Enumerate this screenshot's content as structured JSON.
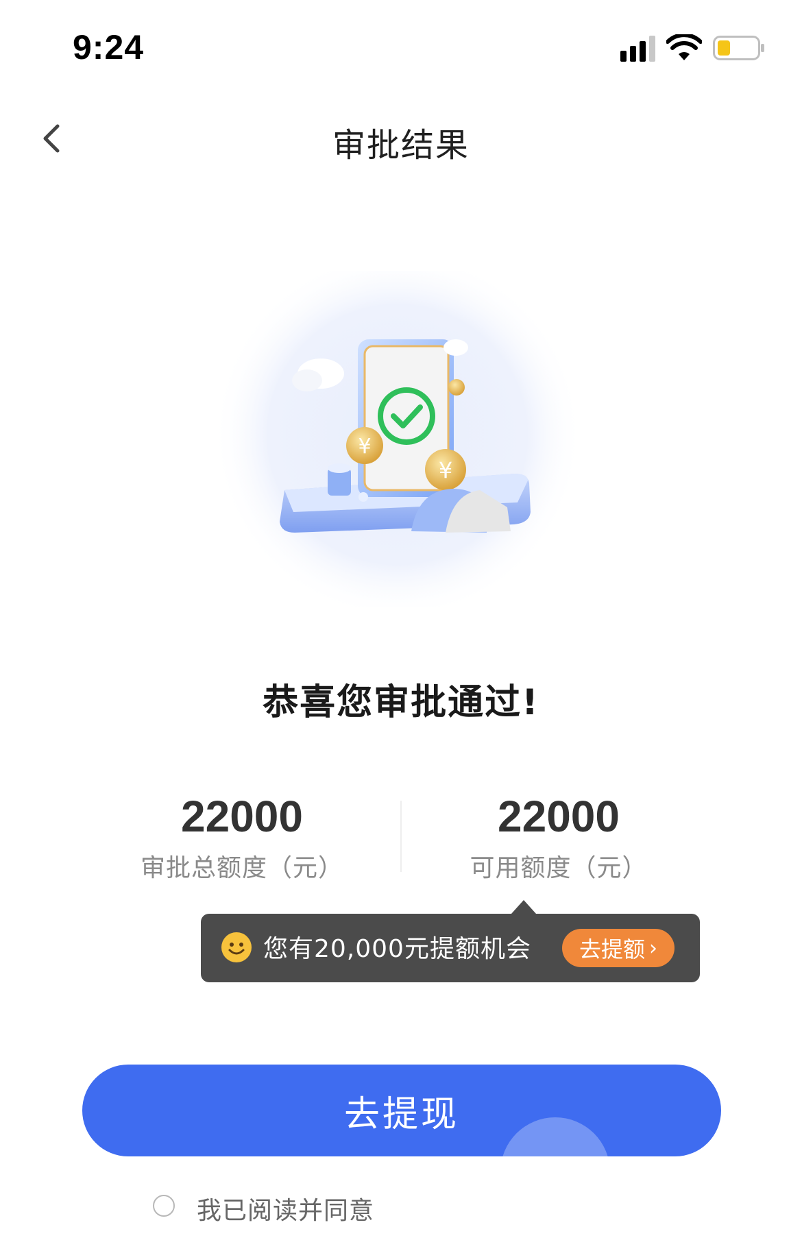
{
  "status_bar": {
    "time": "9:24",
    "signal_icon": "cellular-signal-icon",
    "wifi_icon": "wifi-icon",
    "battery_icon": "battery-icon",
    "battery_color": "#f5c518"
  },
  "nav": {
    "back_icon": "chevron-left-icon",
    "title": "审批结果"
  },
  "illustration": {
    "icon": "approved-phone-illustration",
    "check_color": "#2fbf5a",
    "coin_color": "#e8b44a"
  },
  "message": "恭喜您审批通过!",
  "stats": [
    {
      "value": "22000",
      "label": "审批总额度（元）"
    },
    {
      "value": "22000",
      "label": "可用额度（元）"
    }
  ],
  "tooltip": {
    "icon": "smiley-icon",
    "text": "您有20,000元提额机会",
    "button_label": "去提额",
    "button_icon": "chevron-right-icon",
    "button_color": "#f0883a"
  },
  "primary_button": {
    "label": "去提现",
    "color": "#3f6cf0"
  },
  "agreement": {
    "text": "我已阅读并同意"
  }
}
